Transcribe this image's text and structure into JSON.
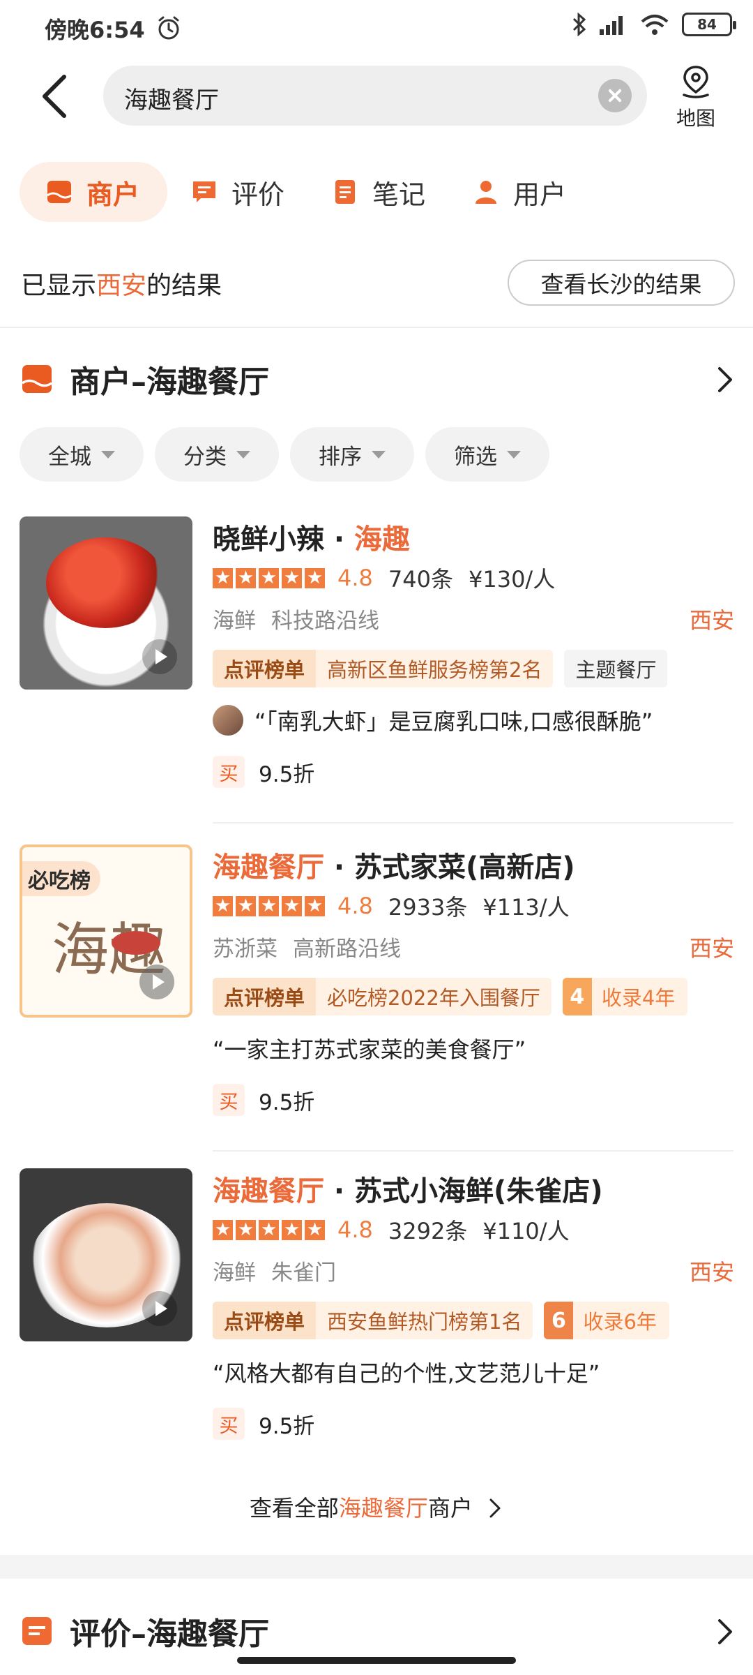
{
  "status_bar": {
    "time": "傍晚6:54",
    "battery": "84"
  },
  "search": {
    "query": "海趣餐厅"
  },
  "map_button": {
    "label": "地图"
  },
  "tabs": [
    {
      "label": "商户",
      "active": true
    },
    {
      "label": "评价",
      "active": false
    },
    {
      "label": "笔记",
      "active": false
    },
    {
      "label": "用户",
      "active": false
    }
  ],
  "city_note": {
    "prefix": "已显示",
    "city": "西安",
    "suffix": "的结果",
    "other_city_button": "查看长沙的结果"
  },
  "merchant_section": {
    "title": "商户–海趣餐厅"
  },
  "filters": [
    "全城",
    "分类",
    "排序",
    "筛选"
  ],
  "results": [
    {
      "title_plain": "晓鲜小辣 · ",
      "title_highlight": "海趣",
      "title_rest": "",
      "rating": "4.8",
      "reviews": "740条",
      "price": "¥130/人",
      "cuisine": "海鲜",
      "area": "科技路沿线",
      "city": "西安",
      "badge_brand": "点评榜单",
      "badge_text": "高新区鱼鲜服务榜第2名",
      "extra_tag": "主题餐厅",
      "quote": "“「南乳大虾」是豆腐乳口味,口感很酥脆”",
      "deal_tag": "买",
      "deal": "9.5折"
    },
    {
      "title_plain": "",
      "title_highlight": "海趣餐厅",
      "title_rest": " · 苏式家菜(高新店)",
      "thumb_badge": "必吃榜",
      "thumb_logo_text": "海趣",
      "rating": "4.8",
      "reviews": "2933条",
      "price": "¥113/人",
      "cuisine": "苏浙菜",
      "area": "高新路沿线",
      "city": "西安",
      "badge_brand": "点评榜单",
      "badge_text": "必吃榜2022年入围餐厅",
      "years_num": "4",
      "years_text": "收录4年",
      "quote": "“一家主打苏式家菜的美食餐厅”",
      "deal_tag": "买",
      "deal": "9.5折"
    },
    {
      "title_plain": "",
      "title_highlight": "海趣餐厅",
      "title_rest": " · 苏式小海鲜(朱雀店)",
      "rating": "4.8",
      "reviews": "3292条",
      "price": "¥110/人",
      "cuisine": "海鲜",
      "area": "朱雀门",
      "city": "西安",
      "badge_brand": "点评榜单",
      "badge_text": "西安鱼鲜热门榜第1名",
      "years_num": "6",
      "years_text": "收录6年",
      "quote": "“风格大都有自己的个性,文艺范儿十足”",
      "deal_tag": "买",
      "deal": "9.5折"
    }
  ],
  "see_all": {
    "prefix": "查看全部",
    "keyword": "海趣餐厅",
    "suffix": "商户"
  },
  "review_section": {
    "title": "评价–海趣餐厅"
  },
  "colors": {
    "accent": "#ea6a3a",
    "star": "#f07c3e",
    "tab_bg": "#fdeee6"
  }
}
